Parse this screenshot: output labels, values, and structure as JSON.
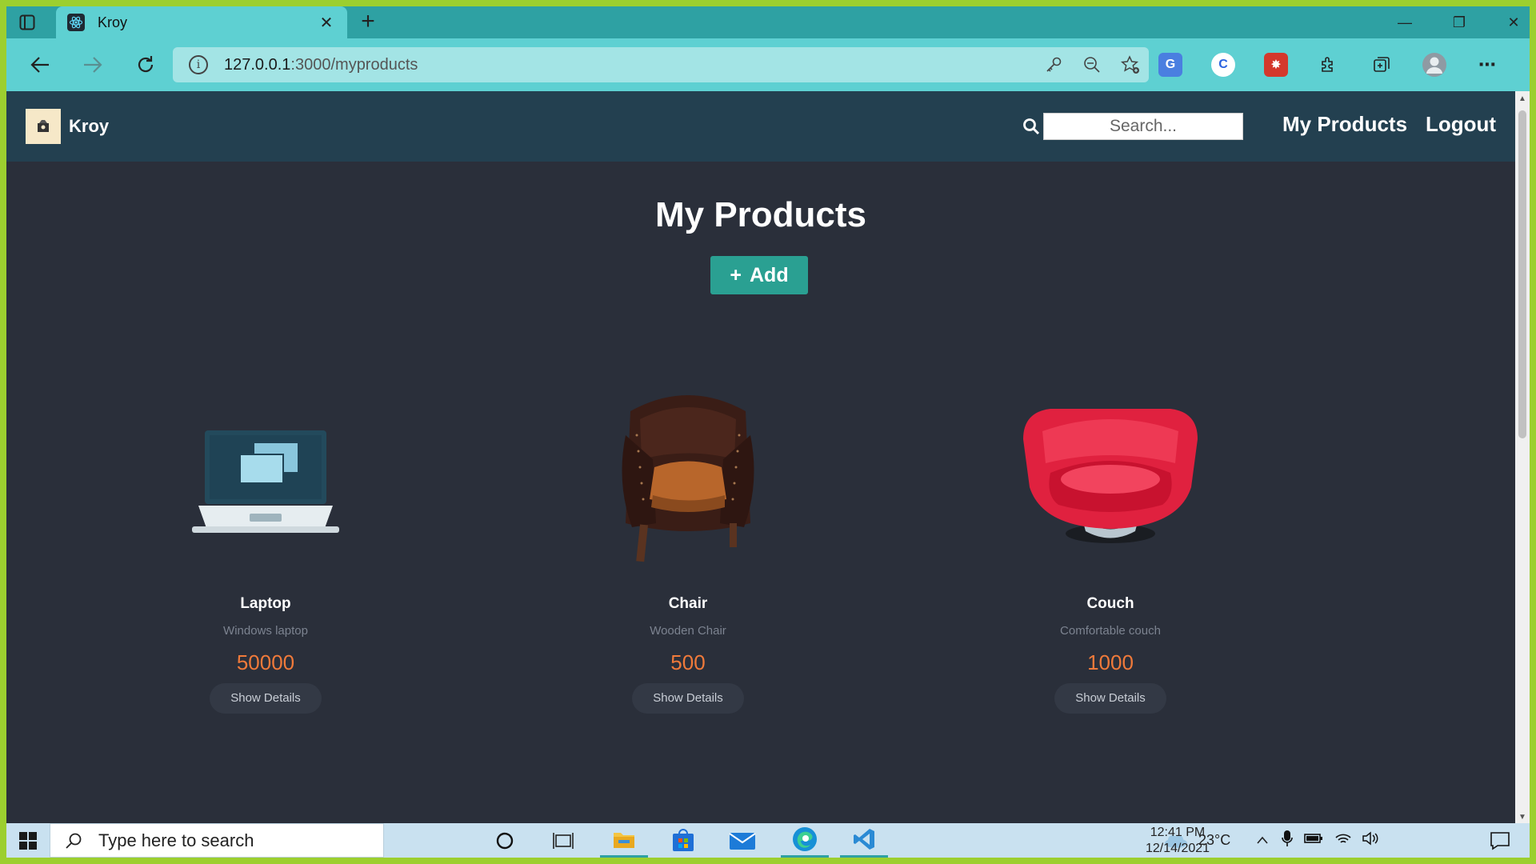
{
  "browser": {
    "tab_title": "Kroy",
    "tab_close": "✕",
    "new_tab": "+",
    "url_host": "127.0.0.1",
    "url_path": ":3000/myproducts",
    "window_controls": {
      "minimize": "—",
      "restore": "❐",
      "close": "✕"
    }
  },
  "app": {
    "brand_name": "Kroy",
    "search_placeholder": "Search...",
    "nav_my_products": "My Products",
    "nav_logout": "Logout",
    "page_title": "My Products",
    "add_button": "Add",
    "add_icon": "+",
    "details_label": "Show Details"
  },
  "products": [
    {
      "name": "Laptop",
      "description": "Windows laptop",
      "price": "50000",
      "image_icon": "laptop-image"
    },
    {
      "name": "Chair",
      "description": "Wooden Chair",
      "price": "500",
      "image_icon": "chair-image"
    },
    {
      "name": "Couch",
      "description": "Comfortable couch",
      "price": "1000",
      "image_icon": "couch-image"
    }
  ],
  "taskbar": {
    "search_text": "Type here to search",
    "temperature": "23°C",
    "time": "12:41 PM",
    "date": "12/14/2021"
  },
  "colors": {
    "tab_bar": "#2ea1a3",
    "toolbar": "#5ed0d2",
    "app_nav": "#234050",
    "page_bg": "#2a2f3a",
    "accent_button": "#2aa092",
    "price": "#f07a3a"
  }
}
